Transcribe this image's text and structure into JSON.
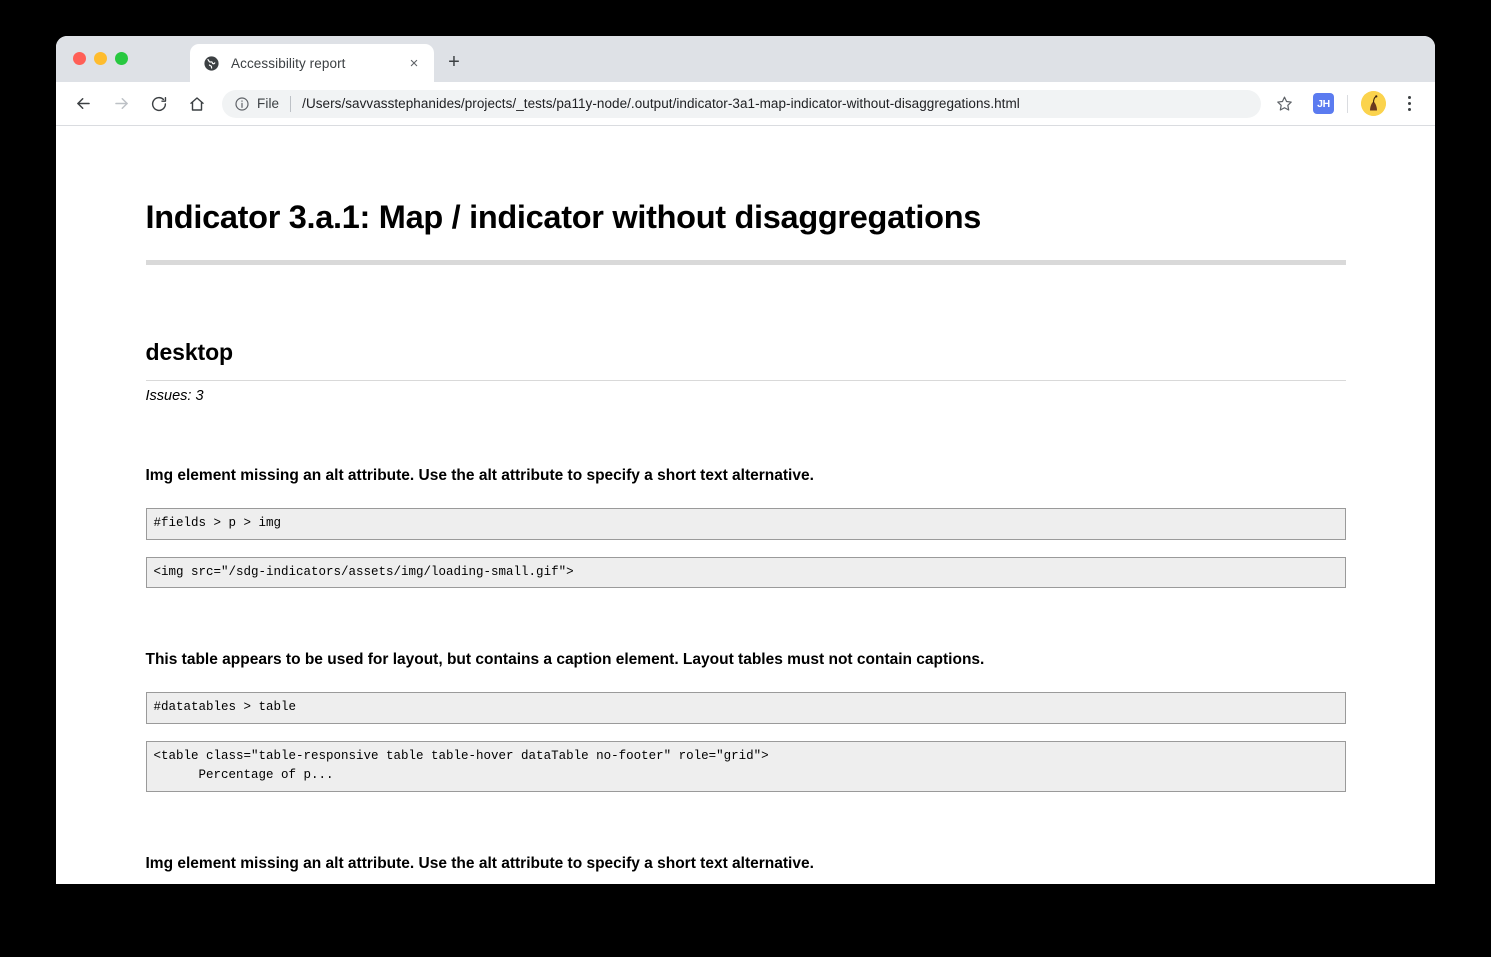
{
  "browser": {
    "traffic_lights": [
      "close",
      "minimize",
      "maximize"
    ],
    "tab": {
      "title": "Accessibility report",
      "favicon": "globe-icon",
      "close_label": "×"
    },
    "new_tab_label": "+",
    "toolbar": {
      "back": "back-arrow-icon",
      "forward": "forward-arrow-icon",
      "reload": "reload-icon",
      "home": "home-icon",
      "scheme_label": "File",
      "url": "/Users/savvasstephanides/projects/_tests/pa11y-node/.output/indicator-3a1-map-indicator-without-disaggregations.html",
      "bookmark": "star-icon",
      "extension_badge": "JH",
      "profile": "avatar-icon",
      "menu": "three-dot-menu-icon"
    }
  },
  "page": {
    "title": "Indicator 3.a.1: Map / indicator without disaggregations",
    "sections": [
      {
        "name": "desktop",
        "issues_count_label": "Issues: 3",
        "issues": [
          {
            "title": "Img element missing an alt attribute. Use the alt attribute to specify a short text alternative.",
            "selector": "#fields > p > img",
            "snippet": "<img src=\"/sdg-indicators/assets/img/loading-small.gif\">"
          },
          {
            "title": "This table appears to be used for layout, but contains a caption element. Layout tables must not contain captions.",
            "selector": "#datatables > table",
            "snippet": "<table class=\"table-responsive table table-hover dataTable no-footer\" role=\"grid\">\n      Percentage of p..."
          },
          {
            "title": "Img element missing an alt attribute. Use the alt attribute to specify a short text alternative.",
            "selector": "",
            "snippet": ""
          }
        ]
      }
    ]
  }
}
